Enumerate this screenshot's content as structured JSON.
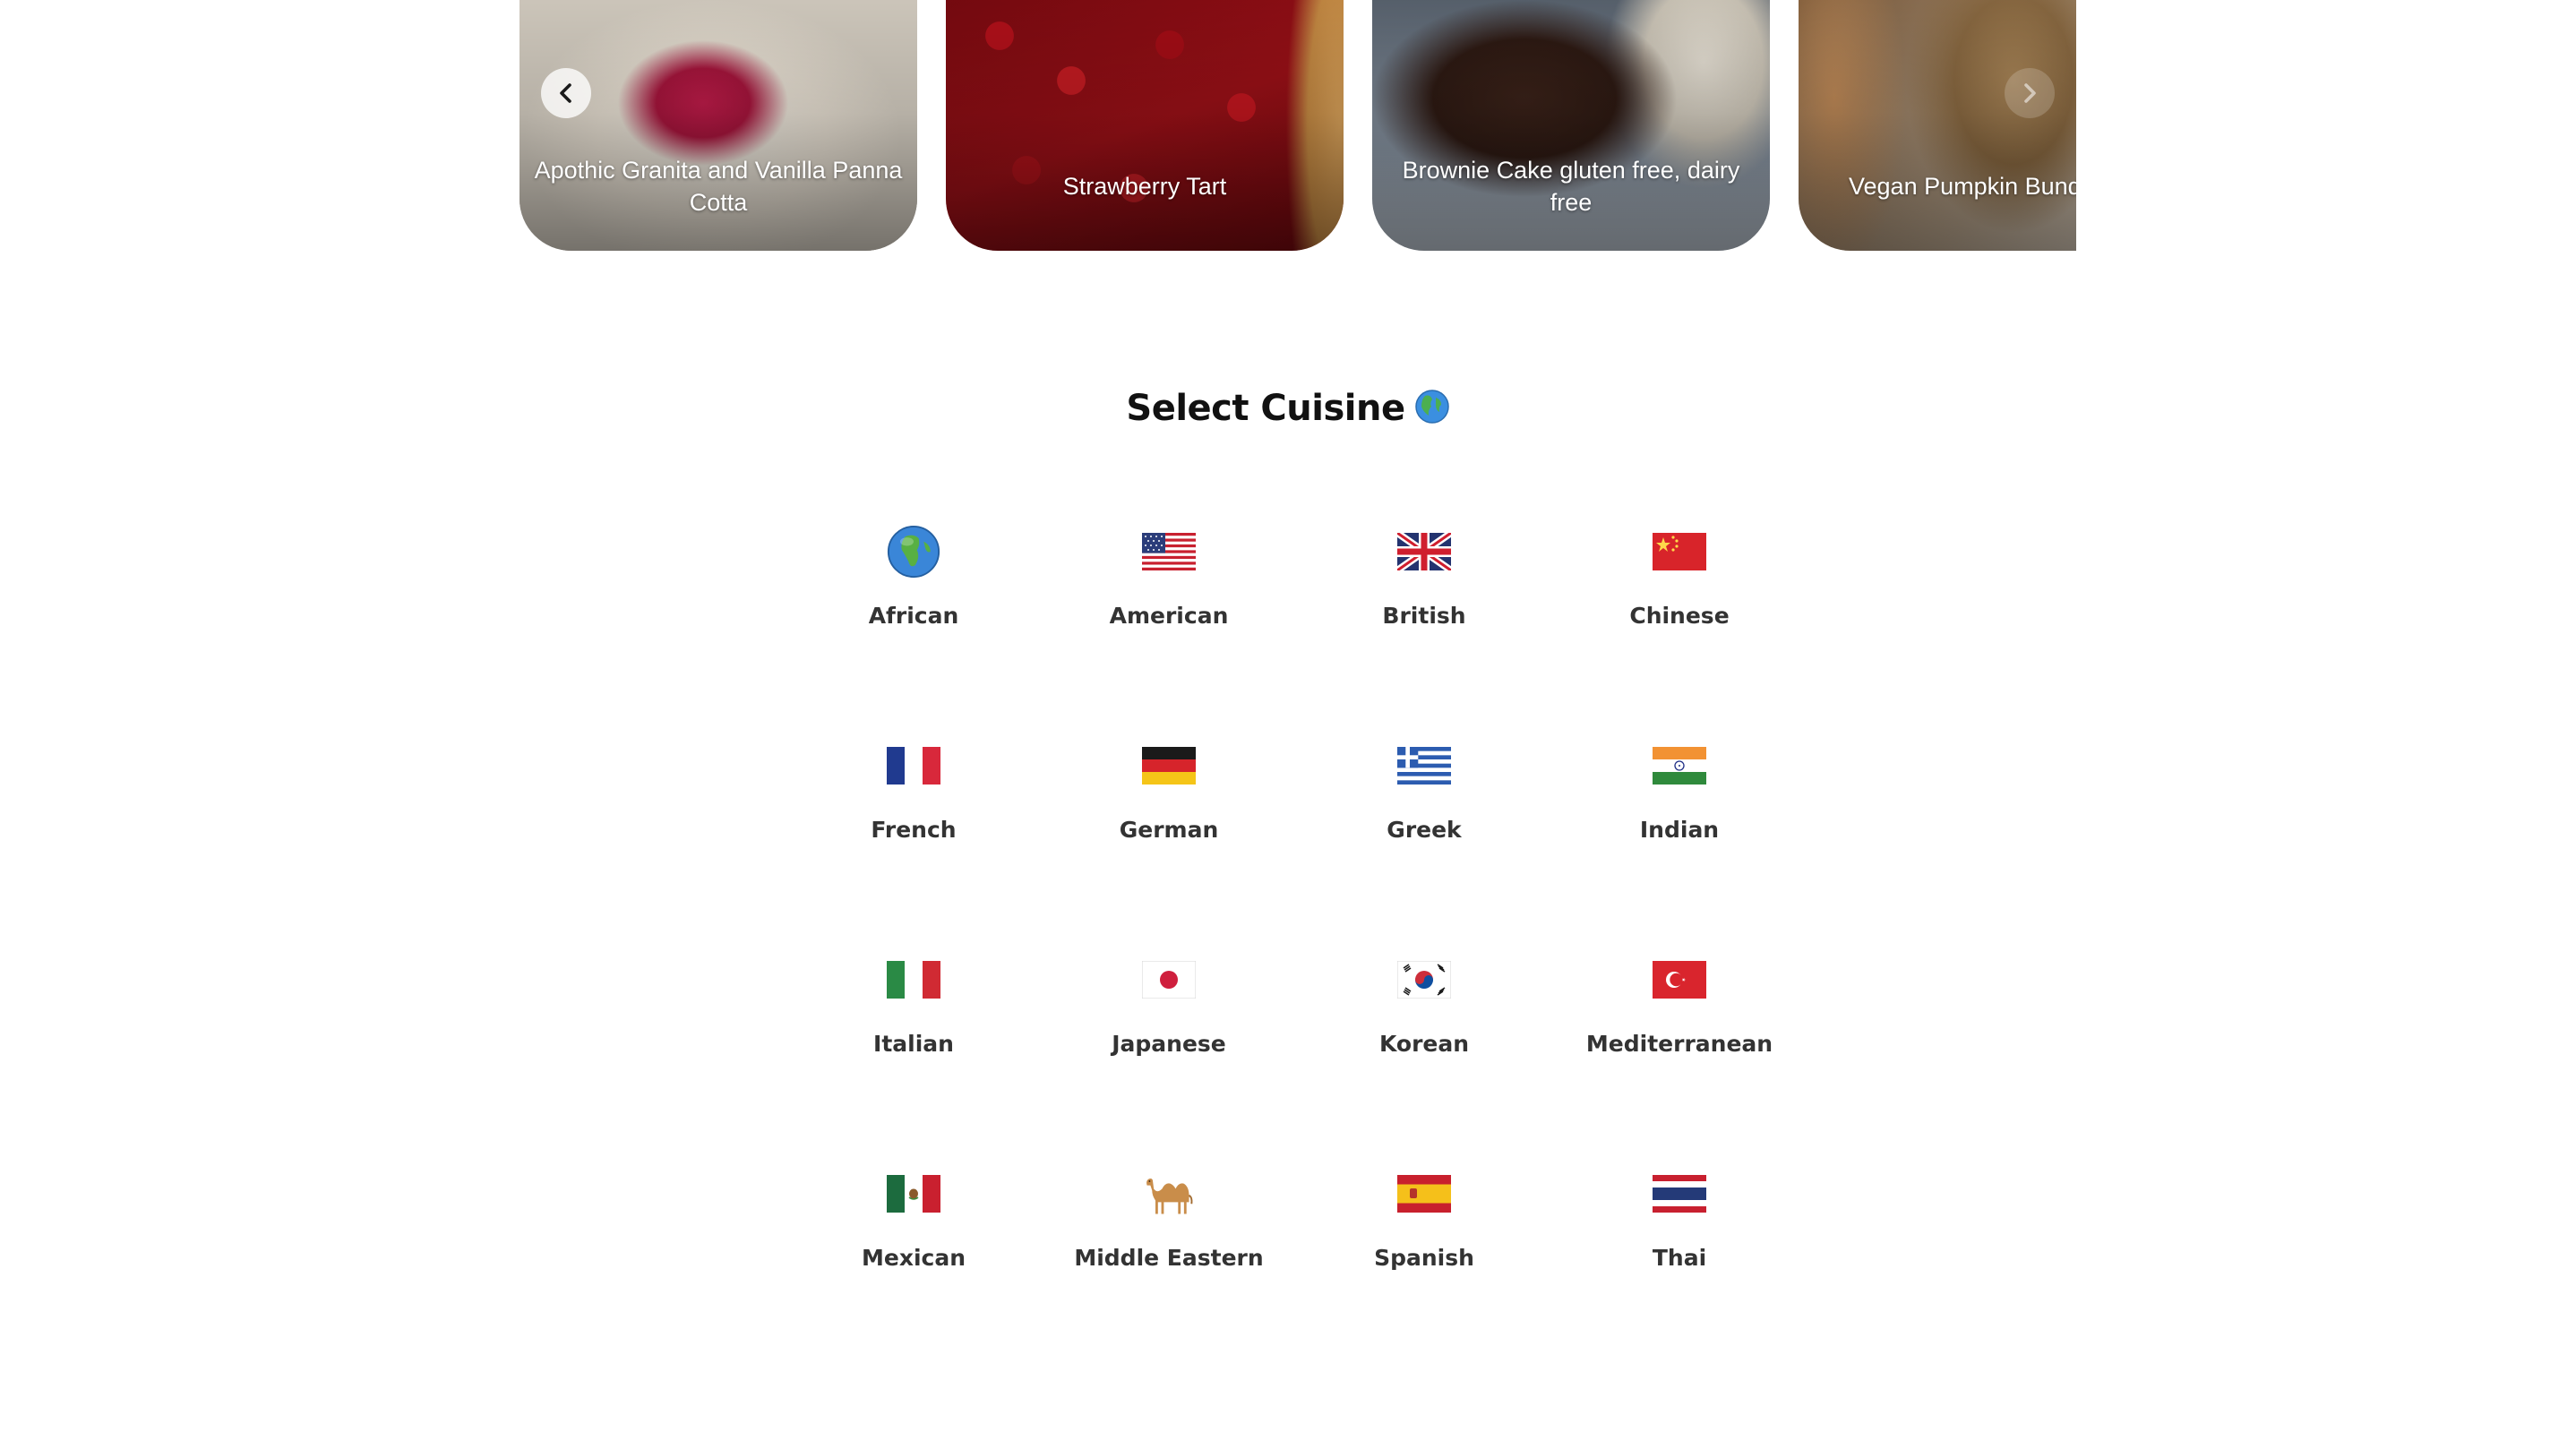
{
  "carousel": {
    "prev_icon": "chevron-left-icon",
    "next_icon": "chevron-right-icon",
    "cards": [
      {
        "title": "Apothic Granita and Vanilla Panna Cotta"
      },
      {
        "title": "Strawberry Tart"
      },
      {
        "title": "Brownie Cake gluten free, dairy free"
      },
      {
        "title": "Vegan Pumpkin Bundt Cake"
      }
    ]
  },
  "cuisine_section": {
    "title": "Select Cuisine",
    "title_icon": "globe-icon"
  },
  "cuisines": [
    {
      "name": "African",
      "icon": "globe-africa-icon"
    },
    {
      "name": "American",
      "icon": "flag-us-icon"
    },
    {
      "name": "British",
      "icon": "flag-uk-icon"
    },
    {
      "name": "Chinese",
      "icon": "flag-china-icon"
    },
    {
      "name": "French",
      "icon": "flag-france-icon"
    },
    {
      "name": "German",
      "icon": "flag-germany-icon"
    },
    {
      "name": "Greek",
      "icon": "flag-greece-icon"
    },
    {
      "name": "Indian",
      "icon": "flag-india-icon"
    },
    {
      "name": "Italian",
      "icon": "flag-italy-icon"
    },
    {
      "name": "Japanese",
      "icon": "flag-japan-icon"
    },
    {
      "name": "Korean",
      "icon": "flag-korea-icon"
    },
    {
      "name": "Mediterranean",
      "icon": "flag-turkey-icon"
    },
    {
      "name": "Mexican",
      "icon": "flag-mexico-icon"
    },
    {
      "name": "Middle Eastern",
      "icon": "camel-icon"
    },
    {
      "name": "Spanish",
      "icon": "flag-spain-icon"
    },
    {
      "name": "Thai",
      "icon": "flag-thailand-icon"
    }
  ]
}
